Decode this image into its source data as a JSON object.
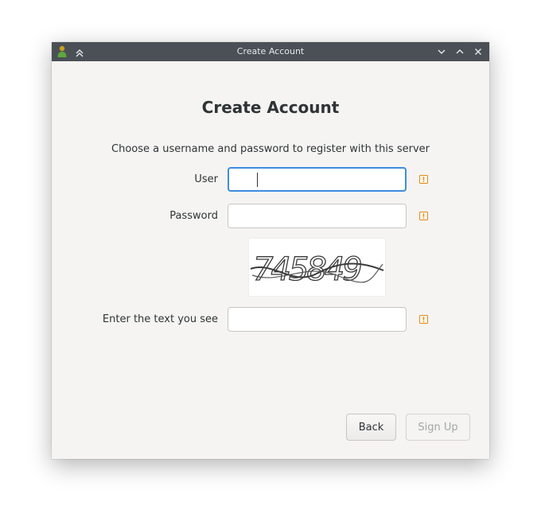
{
  "window": {
    "title": "Create Account",
    "controls": [
      "minimize-icon",
      "maximize-icon",
      "close-icon"
    ]
  },
  "form": {
    "heading": "Create Account",
    "intro": "Choose a username and password to register with this server",
    "user_label": "User",
    "user_value": "",
    "password_label": "Password",
    "password_value": "",
    "captcha_text": "745849",
    "captcha_label": "Enter the text you see",
    "captcha_value": ""
  },
  "buttons": {
    "back": "Back",
    "signup": "Sign Up"
  },
  "colors": {
    "titlebar": "#4a5056",
    "focus": "#3d8de0",
    "warning": "#e08a1a"
  }
}
